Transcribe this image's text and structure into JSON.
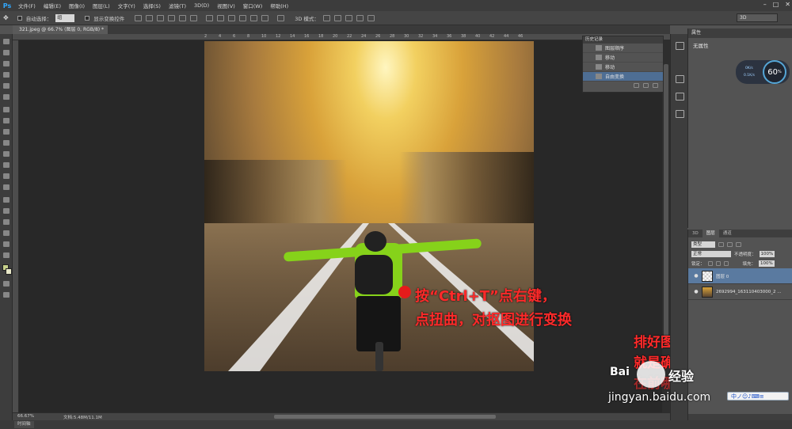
{
  "app": {
    "logo": "Ps"
  },
  "menu": [
    "文件(F)",
    "编辑(E)",
    "图像(I)",
    "图层(L)",
    "文字(Y)",
    "选择(S)",
    "滤镜(T)",
    "3D(D)",
    "视图(V)",
    "窗口(W)",
    "帮助(H)"
  ],
  "window_controls": [
    "–",
    "□",
    "✕"
  ],
  "options": {
    "auto_select_label": "自动选择：",
    "auto_select_value": "组",
    "show_transform_label": "显示变换控件",
    "mode_3d_label": "3D 模式：",
    "workspace_value": "3D"
  },
  "document": {
    "tab_title": "321.jpeg @ 66.7% (图层 0, RGB/8) *"
  },
  "ruler_ticks": [
    "2",
    "4",
    "6",
    "8",
    "10",
    "12",
    "14",
    "16",
    "18",
    "20",
    "22",
    "24",
    "26",
    "28",
    "30",
    "32",
    "34",
    "36",
    "38",
    "40",
    "42",
    "44",
    "46"
  ],
  "history": {
    "title": "历史记录",
    "items": [
      "图层顺序",
      "移动",
      "移动",
      "自由变换"
    ],
    "active_index": 3
  },
  "properties": {
    "tab": "属性",
    "empty_label": "无属性",
    "gauge_value": "60",
    "gauge_unit": "%",
    "widget_line1": "0K/s",
    "widget_line2": "0.1K/s"
  },
  "layers": {
    "tabs": [
      "3D",
      "图层",
      "通道"
    ],
    "active_tab": 1,
    "kind_label": "类型",
    "blend_mode": "正常",
    "opacity_label": "不透明度：",
    "opacity_value": "100%",
    "lock_label": "锁定：",
    "fill_label": "填充：",
    "fill_value": "100%",
    "items": [
      {
        "name": "图层 0",
        "selected": true
      },
      {
        "name": "2692994_163110403000_2 ...",
        "selected": false
      }
    ]
  },
  "status": {
    "zoom": "66.67%",
    "doc_size": "文档:5.48M/11.1M"
  },
  "bottom_tab": "时间轴",
  "annotations": {
    "line1": "按“Ctrl+T”点右键，",
    "line2": "点扭曲，对抠图进行变换",
    "right1": "排好图层顺序，",
    "right2": "就是确定哪个",
    "right3": "在前哪个在后"
  },
  "watermark": {
    "brand": "Bai",
    "brand2": "经验",
    "url": "jingyan.baidu.com"
  },
  "ime": {
    "label": "中ノ☺♪⌨≡"
  },
  "colors": {
    "accent_blue": "#31a8ff",
    "selection_blue": "#4e6e94",
    "annotation_red": "#ff2a2a",
    "jersey_green": "#86d21a"
  }
}
